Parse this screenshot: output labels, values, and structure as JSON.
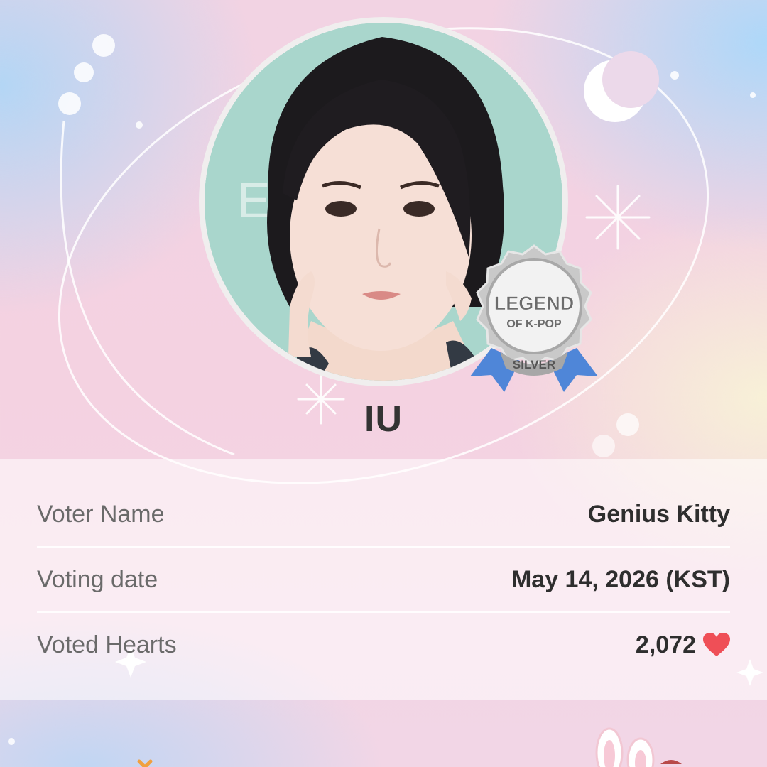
{
  "artist": {
    "name": "IU"
  },
  "badge": {
    "line1": "LEGEND",
    "line2": "OF K-POP",
    "tier": "SILVER"
  },
  "vote_info": {
    "rows": [
      {
        "label": "Voter Name",
        "value": "Genius Kitty"
      },
      {
        "label": "Voting date",
        "value": "May 14, 2026 (KST)"
      },
      {
        "label": "Voted Hearts",
        "value": "2,072",
        "icon": "heart-icon"
      }
    ]
  },
  "colors": {
    "heart": "#ef4f57",
    "badge_ribbon": "#4f86d8",
    "badge_silver": "#bfbfbf"
  }
}
